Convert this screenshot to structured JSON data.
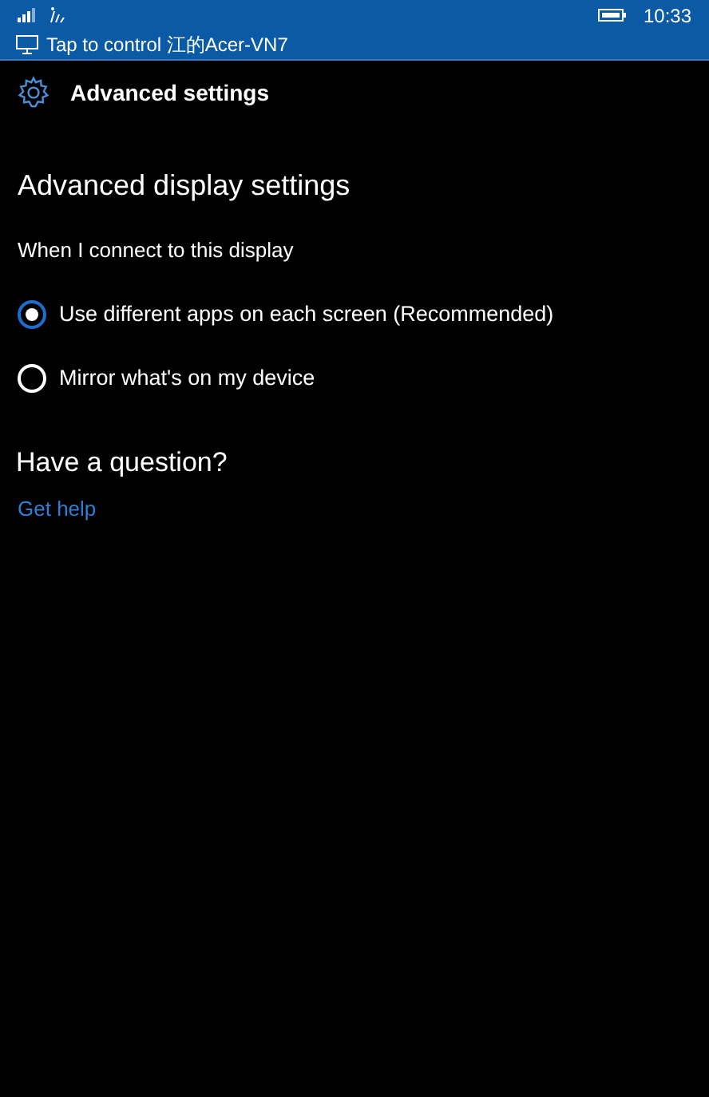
{
  "status_bar": {
    "time": "10:33"
  },
  "banner": {
    "text": "Tap to control 江的Acer-VN7"
  },
  "header": {
    "title": "Advanced settings"
  },
  "section": {
    "title": "Advanced display settings",
    "subtitle": "When I connect to this display"
  },
  "options": [
    {
      "label": "Use different apps on each screen (Recommended)",
      "selected": true
    },
    {
      "label": "Mirror what's on my device",
      "selected": false
    }
  ],
  "help": {
    "title": "Have a question?",
    "link": "Get help"
  }
}
